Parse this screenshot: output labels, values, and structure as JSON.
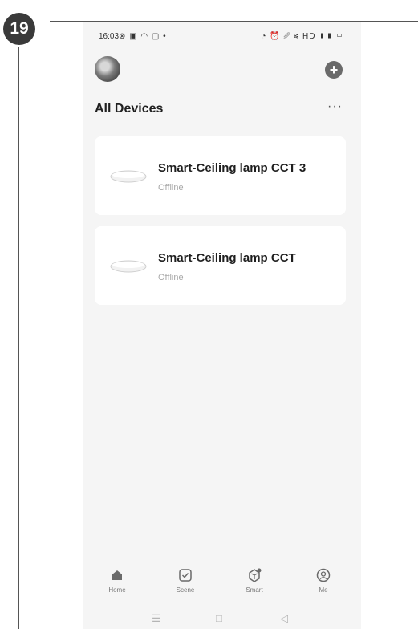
{
  "step": {
    "number": "19"
  },
  "status_bar": {
    "time": "16:03",
    "notification_icons": [
      "whatsapp-icon",
      "media-icon",
      "tuya-icon",
      "gallery-icon",
      "dot-icon"
    ],
    "system_icons": [
      "alarm-icon",
      "vibrate-icon",
      "data-icon",
      "wifi-icon",
      "hd-icon",
      "signal-icon",
      "battery-icon"
    ]
  },
  "header": {
    "title": "All Devices",
    "more_label": "···"
  },
  "devices": [
    {
      "name": "Smart-Ceiling lamp CCT 3",
      "status": "Offline"
    },
    {
      "name": "Smart-Ceiling lamp CCT",
      "status": "Offline"
    }
  ],
  "tabs": [
    {
      "label": "Home",
      "icon": "home-icon"
    },
    {
      "label": "Scene",
      "icon": "scene-icon"
    },
    {
      "label": "Smart",
      "icon": "smart-icon"
    },
    {
      "label": "Me",
      "icon": "me-icon"
    }
  ],
  "system_nav": {
    "menu": "☰",
    "home": "□",
    "back": "◁"
  },
  "colors": {
    "background": "#f5f5f5",
    "card": "#ffffff",
    "offline_text": "#a8a8a8",
    "badge": "#3a3a3a"
  }
}
